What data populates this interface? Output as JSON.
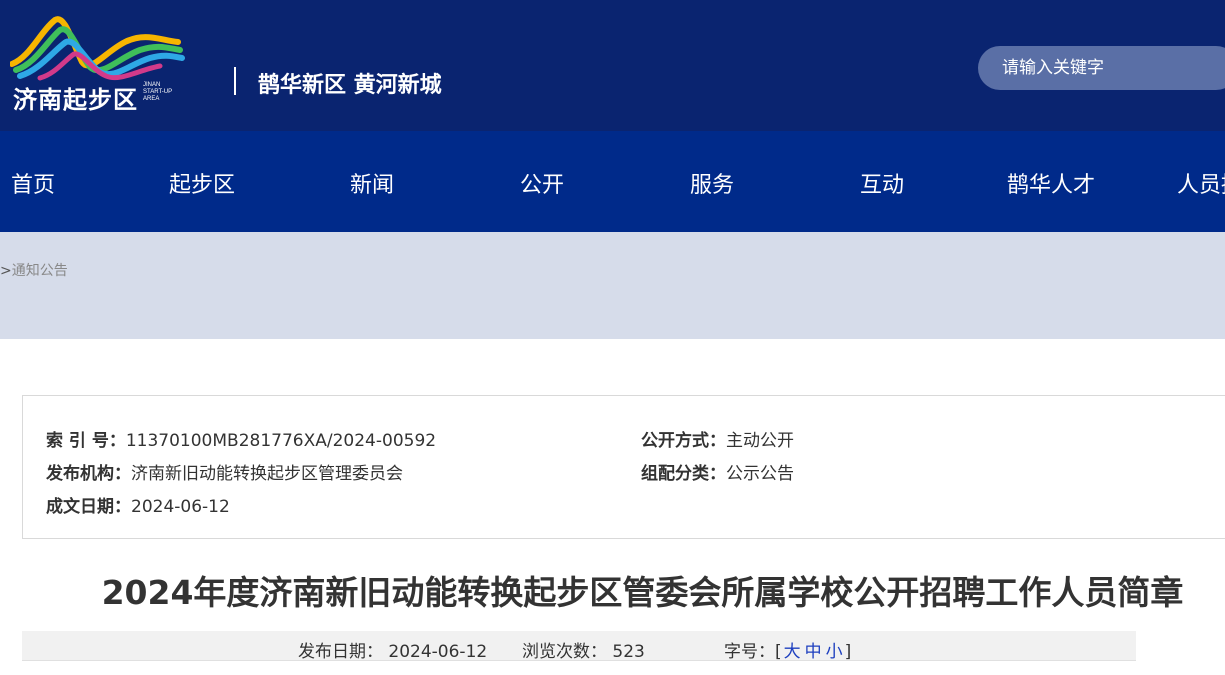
{
  "header": {
    "logo_text": "济南起步区",
    "logo_en": [
      "JINAN",
      "START-UP",
      "AREA"
    ],
    "slogan": "鹊华新区 黄河新城",
    "search_placeholder": "请输入关键字"
  },
  "nav": {
    "items": [
      {
        "label": "首页"
      },
      {
        "label": "起步区"
      },
      {
        "label": "新闻"
      },
      {
        "label": "公开"
      },
      {
        "label": "服务"
      },
      {
        "label": "互动"
      },
      {
        "label": "鹊华人才"
      },
      {
        "label": "人员招"
      }
    ]
  },
  "breadcrumb": {
    "separator": ">",
    "current": "通知公告"
  },
  "meta": {
    "index_label": "索 引 号：",
    "index_value": "11370100MB281776XA/2024-00592",
    "publisher_label": "发布机构：",
    "publisher_value": "济南新旧动能转换起步区管理委员会",
    "date_label": "成文日期：",
    "date_value": "2024-06-12",
    "open_label": "公开方式：",
    "open_value": "主动公开",
    "category_label": "组配分类：",
    "category_value": "公示公告"
  },
  "article": {
    "title": "2024年度济南新旧动能转换起步区管委会所属学校公开招聘工作人员简章",
    "publish_date_label": "发布日期：",
    "publish_date": "2024-06-12",
    "views_label": "浏览次数：",
    "views": "523",
    "font_size_label": "字号：",
    "font_open": "[",
    "font_large": "大",
    "font_medium": "中",
    "font_small": "小",
    "font_close": "]"
  },
  "colors": {
    "header_bg": "#0a2470",
    "nav_bg": "#002a8a",
    "crumb_bg": "#d6dcea",
    "link_blue": "#1d3fbf"
  }
}
